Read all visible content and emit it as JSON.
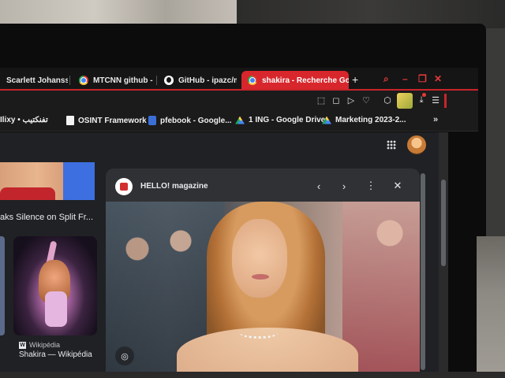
{
  "browser": {
    "tabs": [
      {
        "label": "Scarlett Johansso",
        "favicon": "none-icon",
        "active": false
      },
      {
        "label": "MTCNN github -",
        "favicon": "chrome-icon",
        "active": false
      },
      {
        "label": "GitHub - ipazc/m",
        "favicon": "github-icon",
        "active": false
      },
      {
        "label": "shakira - Recherche Goo",
        "favicon": "chrome-icon",
        "active": true
      }
    ],
    "new_tab": "+",
    "window_controls": {
      "search": "⌕",
      "minimize": "–",
      "restore": "❐",
      "close": "✕"
    },
    "toolbar_icons": [
      "⬚",
      "◻",
      "▷",
      "♡",
      "⬡",
      "",
      "⤓",
      "☰"
    ],
    "accent_color": "#d7262c",
    "bookmarks": [
      {
        "label": "Ilixy • تفنكتيب",
        "icon": "none"
      },
      {
        "label": "OSINT Framework",
        "icon": "doc-icon"
      },
      {
        "label": "pfebook - Google...",
        "icon": "pfe-icon"
      },
      {
        "label": "1 ING - Google Drive",
        "icon": "drive-icon"
      },
      {
        "label": "Marketing 2023-2...",
        "icon": "drive-icon"
      }
    ],
    "bookmarks_more": "»"
  },
  "results": {
    "caption_left": "aks Silence on Split Fr...",
    "wiki_source": "Wikipédia",
    "wiki_title": "Shakira — Wikipédia"
  },
  "preview": {
    "source_name": "HELLO! magazine",
    "prev": "‹",
    "next": "›",
    "more": "⋮",
    "close": "✕",
    "lens": "◎"
  }
}
